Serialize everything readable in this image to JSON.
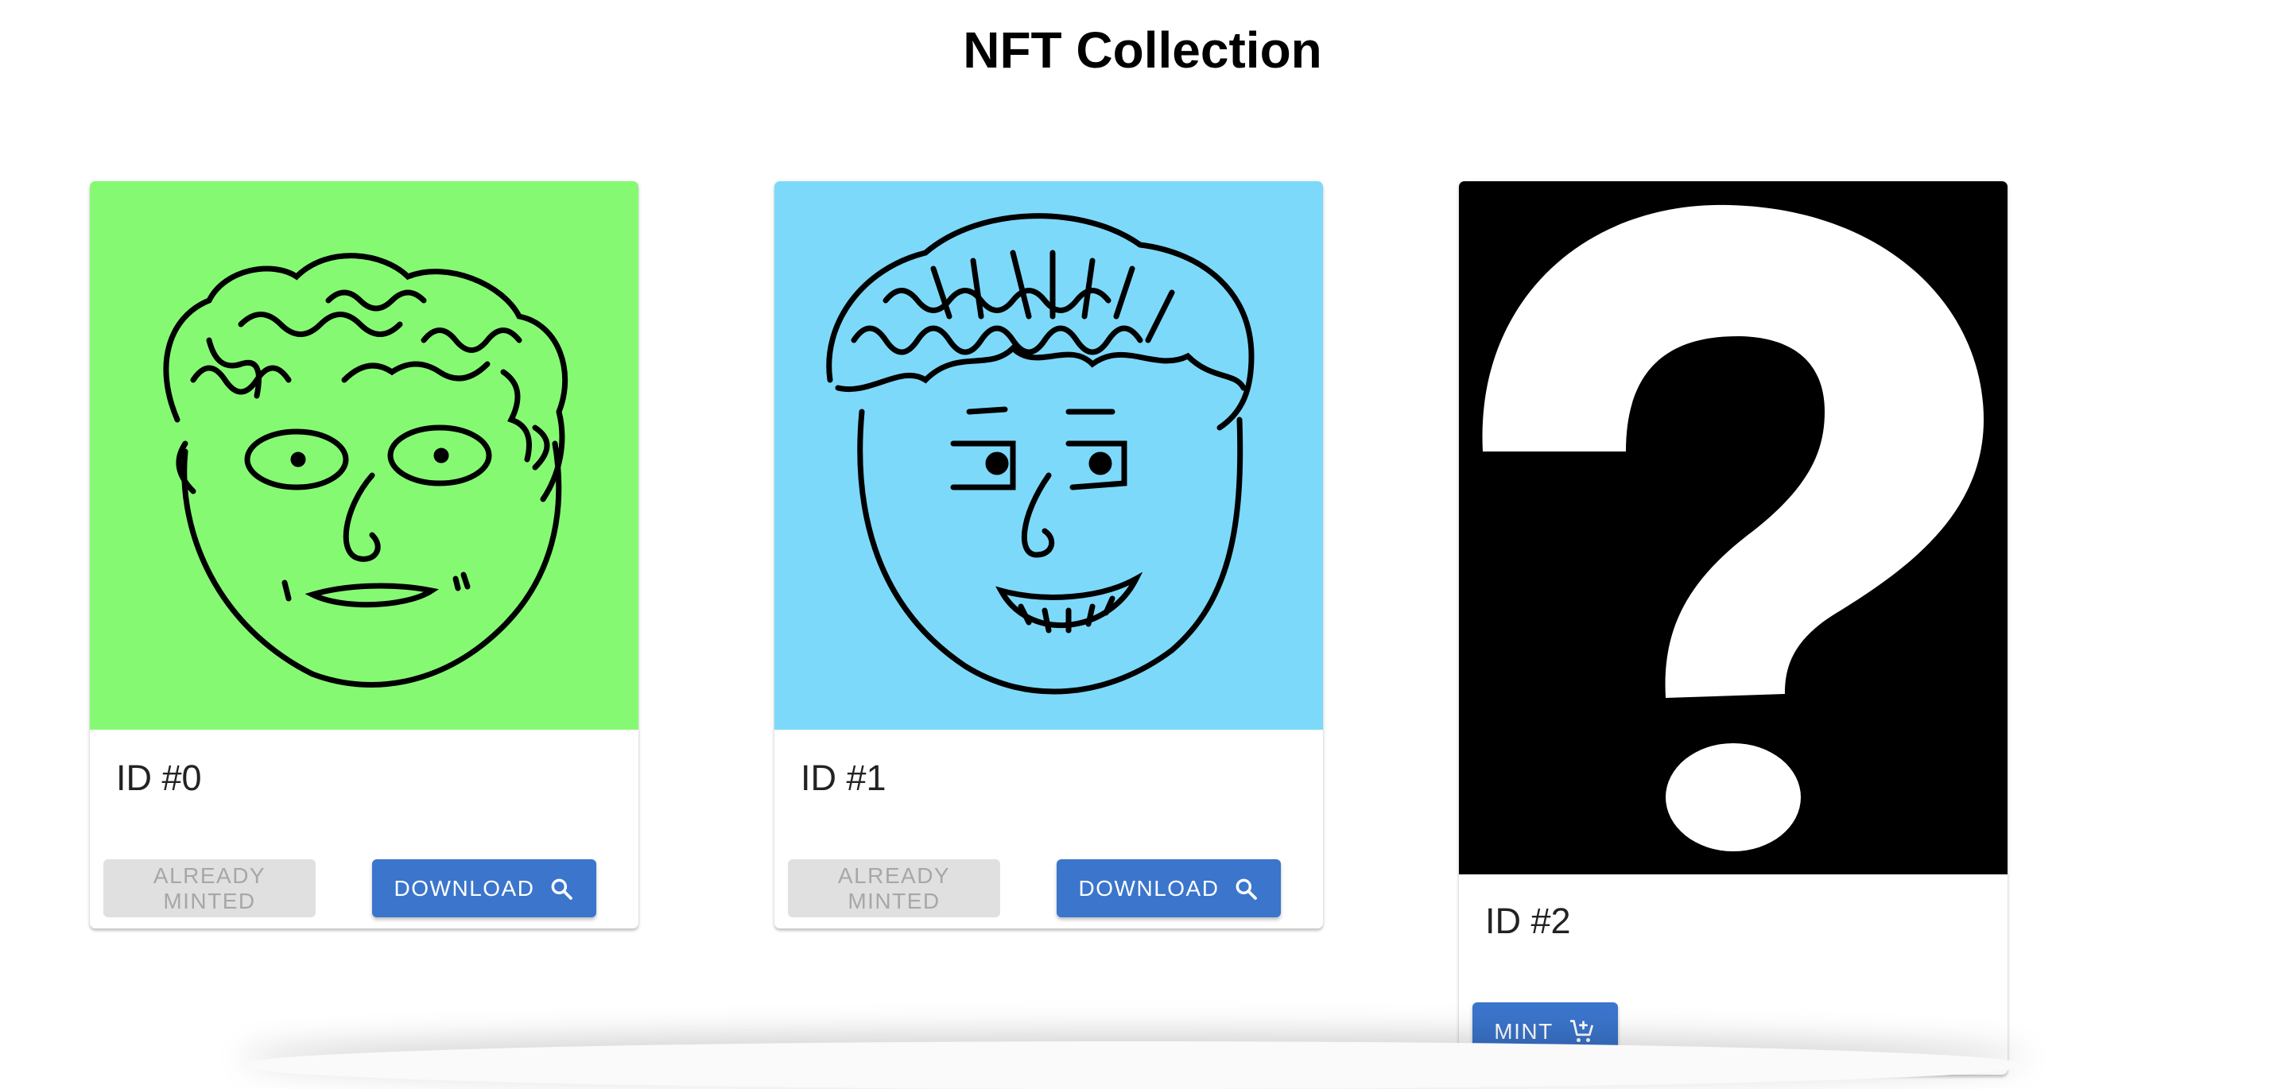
{
  "page": {
    "title": "NFT Collection"
  },
  "cards": [
    {
      "id_label": "ID #0",
      "image": "green-face-curly-hair",
      "background": "#86f973",
      "secondary_label": "ALREADY MINTED",
      "primary_label": "DOWNLOAD",
      "primary_icon": "search-icon"
    },
    {
      "id_label": "ID #1",
      "image": "blue-face-smiling",
      "background": "#7dd9f9",
      "secondary_label": "ALREADY MINTED",
      "primary_label": "DOWNLOAD",
      "primary_icon": "search-icon"
    },
    {
      "id_label": "ID #2",
      "image": "question-mark",
      "background": "#000000",
      "primary_label": "MINT",
      "primary_icon": "add-shopping-cart-icon"
    }
  ],
  "colors": {
    "primary_button": "#3b75cc",
    "disabled_button": "#e0e0e0",
    "disabled_text": "#a7a7a7"
  }
}
